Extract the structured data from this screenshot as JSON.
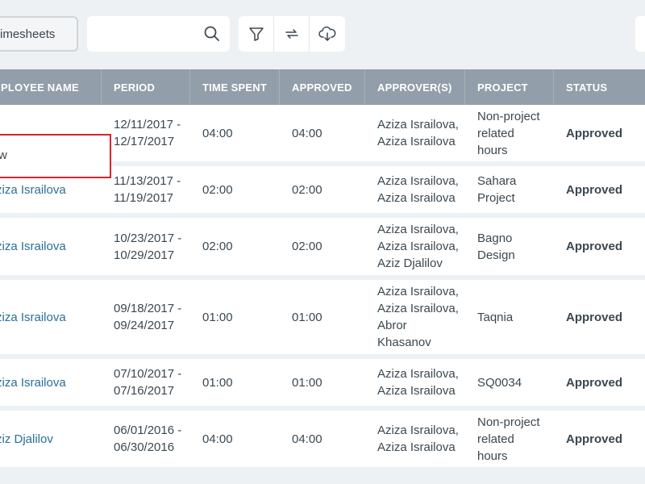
{
  "toolbar": {
    "timesheets_label": "imesheets",
    "search_placeholder": ""
  },
  "table": {
    "headers": [
      "MPLOYEE NAME",
      "PERIOD",
      "TIME SPENT",
      "APPROVED",
      "APPROVER(S)",
      "PROJECT",
      "STATUS"
    ],
    "rows": [
      {
        "employee": "",
        "period1": "12/11/2017 -",
        "period2": "12/17/2017",
        "time": "04:00",
        "approved": "04:00",
        "approvers": [
          "Aziza Israilova,",
          "Aziza Israilova"
        ],
        "project": [
          "Non-project",
          "related",
          "hours"
        ],
        "status": "Approved"
      },
      {
        "employee": "ziza Israilova",
        "period1": "11/13/2017 -",
        "period2": "11/19/2017",
        "time": "02:00",
        "approved": "02:00",
        "approvers": [
          "Aziza Israilova,",
          "Aziza Israilova"
        ],
        "project": [
          "Sahara",
          "Project"
        ],
        "status": "Approved"
      },
      {
        "employee": "ziza Israilova",
        "period1": "10/23/2017 -",
        "period2": "10/29/2017",
        "time": "02:00",
        "approved": "02:00",
        "approvers": [
          "Aziza Israilova,",
          "Aziza Israilova,",
          "Aziz Djalilov"
        ],
        "project": [
          "Bagno",
          "Design"
        ],
        "status": "Approved"
      },
      {
        "employee": "ziza Israilova",
        "period1": "09/18/2017 -",
        "period2": "09/24/2017",
        "time": "01:00",
        "approved": "01:00",
        "approvers": [
          "Aziza Israilova,",
          "Aziza Israilova,",
          "Abror",
          "Khasanov"
        ],
        "project": [
          "Taqnia"
        ],
        "status": "Approved"
      },
      {
        "employee": "ziza Israilova",
        "period1": "07/10/2017 -",
        "period2": "07/16/2017",
        "time": "01:00",
        "approved": "01:00",
        "approvers": [
          "Aziza Israilova,",
          "Aziza Israilova"
        ],
        "project": [
          "SQ0034"
        ],
        "status": "Approved"
      },
      {
        "employee": "ziz Djalilov",
        "period1": "06/01/2016 -",
        "period2": "06/30/2016",
        "time": "04:00",
        "approved": "04:00",
        "approvers": [
          "Aziza Israilova,",
          "Aziza Israilova"
        ],
        "project": [
          "Non-project",
          "related",
          "hours"
        ],
        "status": "Approved"
      }
    ]
  },
  "popup": {
    "text": "w"
  }
}
